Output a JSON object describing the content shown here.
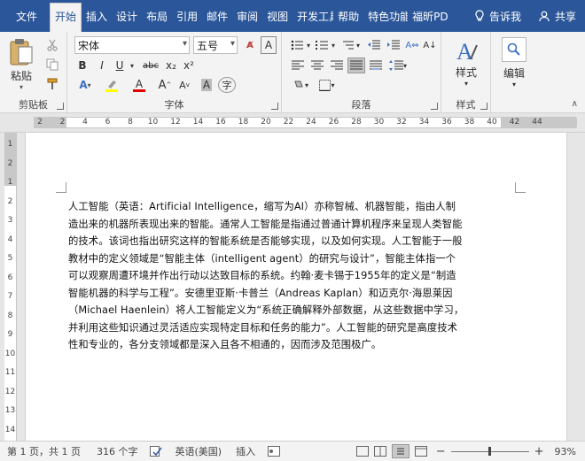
{
  "tabs": {
    "file": "文件",
    "home": "开始",
    "insert": "插入",
    "design": "设计",
    "layout": "布局",
    "references": "引用",
    "mailings": "邮件",
    "review": "审阅",
    "view": "视图",
    "developer": "开发工具",
    "help": "帮助",
    "features": "特色功能",
    "foxit": "福昕PD"
  },
  "tellme": "告诉我",
  "share": "共享",
  "ribbon": {
    "clipboard": {
      "label": "剪贴板",
      "paste": "粘贴"
    },
    "font": {
      "label": "字体",
      "font_name": "宋体",
      "font_size": "五号",
      "bold": "B",
      "italic": "I",
      "underline": "U",
      "strike": "abc",
      "subscript": "x₂",
      "superscript": "x²",
      "grow": "A",
      "shrink": "A",
      "phonetic": "A",
      "char_border": "A",
      "highlight_color": "#ffff00",
      "font_color": "#e00000"
    },
    "paragraph": {
      "label": "段落"
    },
    "styles": {
      "label": "样式",
      "button": "样式"
    },
    "editing": {
      "button": "编辑"
    }
  },
  "ruler": {
    "numbers": [
      "2",
      "2",
      "4",
      "6",
      "8",
      "10",
      "12",
      "14",
      "16",
      "18",
      "20",
      "22",
      "24",
      "26",
      "28",
      "30",
      "32",
      "34",
      "36",
      "38",
      "40",
      "42",
      "44"
    ],
    "vnumbers": [
      "1",
      "2",
      "1",
      "2",
      "3",
      "4",
      "5",
      "6",
      "7",
      "8",
      "9",
      "10",
      "11",
      "12",
      "13",
      "14"
    ]
  },
  "document": {
    "lines": [
      "人工智能（英语：Artificial Intelligence，缩写为AI）亦称智械、机器智能，指由人制",
      "造出来的机器所表现出来的智能。通常人工智能是指通过普通计算机程序来呈现人类智能",
      "的技术。该词也指出研究这样的智能系统是否能够实现，以及如何实现。人工智能于一般",
      "教材中的定义领域是“智能主体（intelligent agent）的研究与设计”，智能主体指一个",
      "可以观察周遭环境并作出行动以达致目标的系统。约翰·麦卡锡于1955年的定义是“制造",
      "智能机器的科学与工程”。安德里亚斯·卡普兰（Andreas Kaplan）和迈克尔·海恩莱因",
      "（Michael Haenlein）将人工智能定义为“系统正确解释外部数据，从这些数据中学习，",
      "并利用这些知识通过灵活适应实现特定目标和任务的能力”。人工智能的研究是高度技术",
      "性和专业的，各分支领域都是深入且各不相通的，因而涉及范围极广。"
    ]
  },
  "status": {
    "page": "第 1 页，共 1 页",
    "words": "316 个字",
    "language": "英语(美国)",
    "mode": "插入",
    "zoom": "93%"
  }
}
